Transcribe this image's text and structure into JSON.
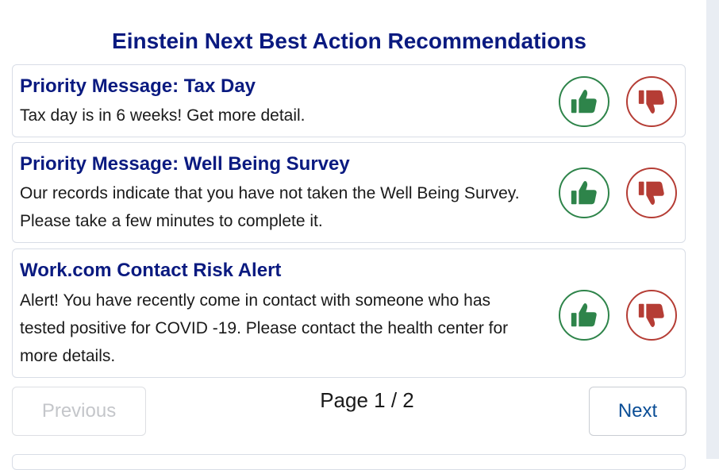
{
  "title": "Einstein Next Best Action Recommendations",
  "colors": {
    "title": "#0a1a80",
    "accept": "#2e844a",
    "reject": "#b53d35",
    "link": "#0b4e96"
  },
  "recommendations": [
    {
      "title": "Priority Message: Tax Day",
      "body": "Tax day is in 6 weeks! Get more detail.",
      "accept_icon": "thumbs-up-icon",
      "reject_icon": "thumbs-down-icon"
    },
    {
      "title": "Priority Message: Well Being Survey",
      "body": "Our records indicate that you have not taken the Well Being Survey. Please take a few minutes to complete it.",
      "accept_icon": "thumbs-up-icon",
      "reject_icon": "thumbs-down-icon"
    },
    {
      "title": "Work.com Contact Risk Alert",
      "body": "Alert! You have recently come in contact with someone who has tested positive for COVID -19. Please contact the health center for more details.",
      "accept_icon": "thumbs-up-icon",
      "reject_icon": "thumbs-down-icon"
    }
  ],
  "pagination": {
    "previous_label": "Previous",
    "next_label": "Next",
    "page_text": "Page 1 / 2"
  }
}
